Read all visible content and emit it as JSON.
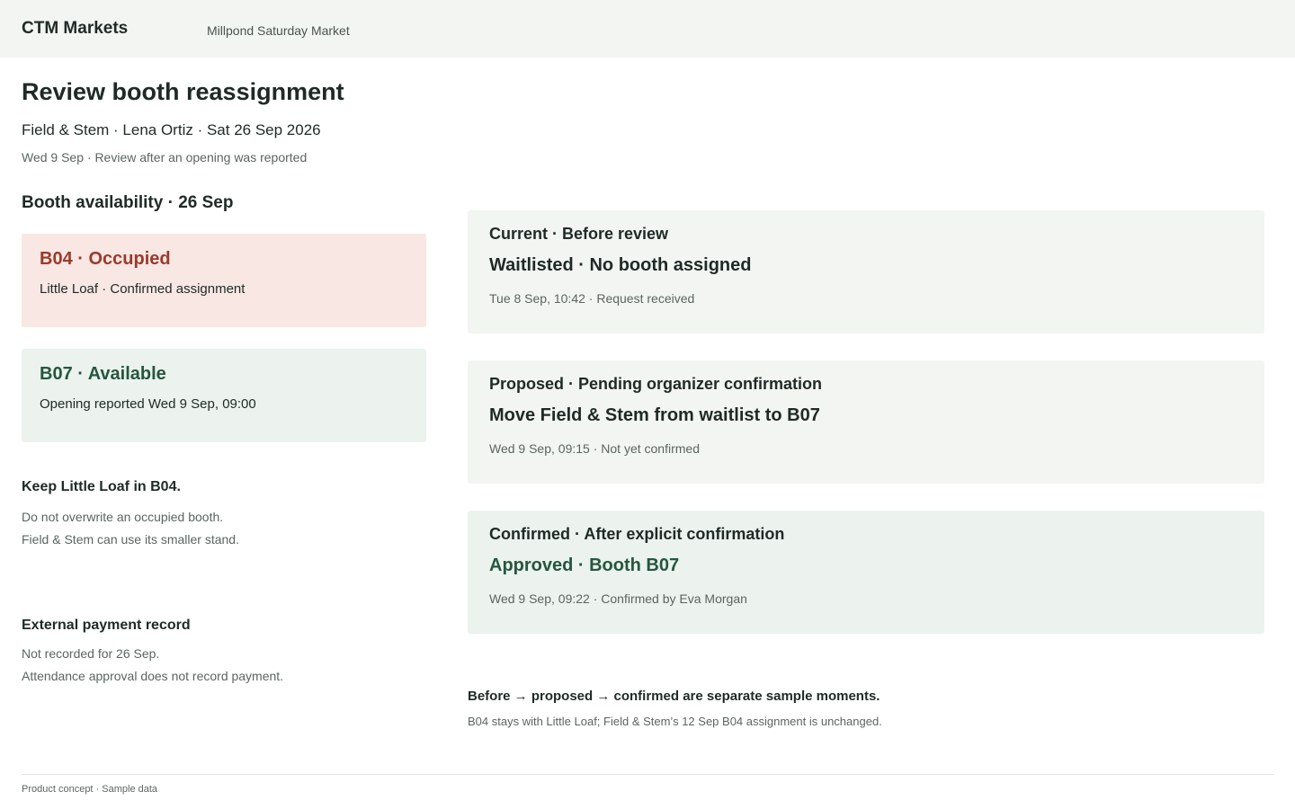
{
  "header": {
    "brand": "CTM Markets",
    "market": "Millpond Saturday Market"
  },
  "review": {
    "title": "Review booth reassignment",
    "subject": "Field & Stem · Lena Ortiz · Sat 26 Sep 2026",
    "context": "Wed 9 Sep · Review after an opening was reported"
  },
  "availability": {
    "title": "Booth availability · 26 Sep",
    "booths": [
      {
        "title": "B04 · Occupied",
        "detail": "Little Loaf · Confirmed assignment",
        "status": "occupied",
        "color": "#9a3a2c"
      },
      {
        "title": "B07 · Available",
        "detail": "Opening reported Wed 9 Sep, 09:00",
        "status": "available",
        "color": "#24573f"
      }
    ]
  },
  "keep_note": {
    "title": "Keep Little Loaf in B04.",
    "lines": [
      "Do not overwrite an occupied booth.",
      "Field & Stem can use its smaller stand."
    ]
  },
  "payment_note": {
    "title": "External payment record",
    "lines": [
      "Not recorded for 26 Sep.",
      "Attendance approval does not record payment."
    ]
  },
  "states": [
    {
      "label": "Current · Before review",
      "value": "Waitlisted · No booth assigned",
      "meta": "Tue 8 Sep, 10:42 · Request received"
    },
    {
      "label": "Proposed · Pending organizer confirmation",
      "value": "Move Field & Stem from waitlist to B07",
      "meta": "Wed 9 Sep, 09:15 · Not yet confirmed"
    },
    {
      "label": "Confirmed · After explicit confirmation",
      "value": "Approved · Booth B07",
      "meta": "Wed 9 Sep, 09:22 · Confirmed by Eva Morgan"
    }
  ],
  "sample_note": {
    "title": "Before → proposed → confirmed are separate sample moments.",
    "detail": "B04 stays with Little Loaf; Field & Stem’s 12 Sep B04 assignment is unchanged."
  },
  "footer": {
    "text": "Product concept · Sample data"
  },
  "colors": {
    "accent_green": "#24573f",
    "accent_red": "#9a3a2c",
    "occupied_bg": "#f8e7e3",
    "available_bg": "#ecf2ee",
    "card_bg": "#f3f5f2"
  }
}
